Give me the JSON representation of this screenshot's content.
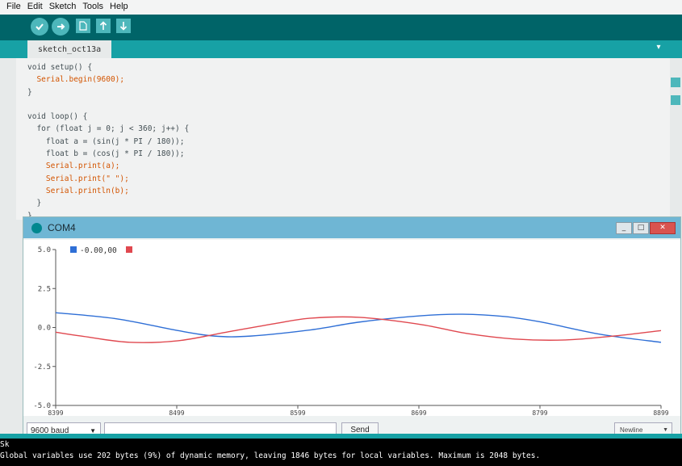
{
  "menu": [
    "File",
    "Edit",
    "Sketch",
    "Tools",
    "Help"
  ],
  "toolbar": {
    "verify_icon": "check-icon",
    "upload_icon": "arrow-right-icon",
    "new_icon": "file-icon",
    "open_icon": "arrow-up-icon",
    "save_icon": "arrow-down-icon"
  },
  "tab": {
    "label": "sketch_oct13a"
  },
  "code_lines": [
    "void setup() {",
    "  Serial.begin(9600);",
    "}",
    "",
    "void loop() {",
    "  for (float j = 0; j < 360; j++) {",
    "    float a = (sin(j * PI / 180));",
    "    float b = (cos(j * PI / 180));",
    "    Serial.print(a);",
    "    Serial.print(\" \");",
    "    Serial.println(b);",
    "  }",
    "}"
  ],
  "monitor": {
    "title": "COM4",
    "legend_text": "-0.00,00",
    "baud": "9600 baud",
    "send_label": "Send",
    "newline": "Newline"
  },
  "chart_data": {
    "type": "line",
    "ylim": [
      -5.0,
      5.0
    ],
    "y_ticks": [
      "5.0",
      "2.5",
      "0.0",
      "-2.5",
      "-5.0"
    ],
    "x_ticks": [
      "8399",
      "8499",
      "8599",
      "8699",
      "8799",
      "8899"
    ],
    "grid": false,
    "series": [
      {
        "color": "#2f6fd6",
        "x": [
          8399,
          8450,
          8500,
          8530,
          8560,
          8610,
          8650,
          8700,
          8735,
          8770,
          8800,
          8850,
          8899
        ],
        "y": [
          0.95,
          0.55,
          -0.2,
          -0.55,
          -0.55,
          -0.15,
          0.35,
          0.75,
          0.85,
          0.7,
          0.35,
          -0.45,
          -0.95
        ]
      },
      {
        "color": "#e0484f",
        "x": [
          8399,
          8420,
          8460,
          8500,
          8540,
          8580,
          8610,
          8650,
          8700,
          8740,
          8780,
          8820,
          8860,
          8899
        ],
        "y": [
          -0.3,
          -0.55,
          -0.95,
          -0.85,
          -0.3,
          0.25,
          0.6,
          0.65,
          0.2,
          -0.4,
          -0.75,
          -0.8,
          -0.55,
          -0.2
        ]
      }
    ]
  },
  "console": {
    "line1": "Sk",
    "line2": "Global variables use 202 bytes (9%) of dynamic memory, leaving 1846 bytes for local variables. Maximum is 2048 bytes."
  },
  "colors": {
    "toolbar": "#006468",
    "tab_strip": "#17a1a5",
    "series_blue": "#2f6fd6",
    "series_red": "#e0484f"
  }
}
